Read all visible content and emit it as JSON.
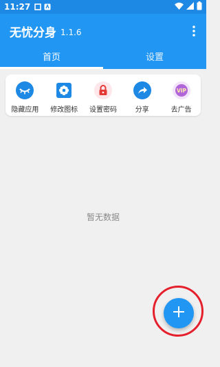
{
  "status_bar": {
    "time": "11:27",
    "notification_icons": [
      "square-icon",
      "app-icon"
    ],
    "right_icons": [
      "wifi-icon",
      "signal-icon",
      "battery-icon"
    ]
  },
  "app_bar": {
    "title": "无忧分身",
    "version": "1.1.6",
    "menu_icon": "more-vert-icon"
  },
  "tabs": [
    {
      "label": "首页",
      "active": true
    },
    {
      "label": "设置",
      "active": false
    }
  ],
  "quick_actions": [
    {
      "label": "隐藏应用",
      "icon": "closed-eye-icon",
      "color": "#1e88e5"
    },
    {
      "label": "修改图标",
      "icon": "flower-icon",
      "color": "#1e88e5"
    },
    {
      "label": "设置密码",
      "icon": "lock-icon",
      "color": "#e53935"
    },
    {
      "label": "分享",
      "icon": "share-arrow-icon",
      "color": "#1e88e5"
    },
    {
      "label": "去广告",
      "icon": "vip-icon",
      "color": "#b066d8"
    }
  ],
  "empty_state": {
    "text": "暂无数据"
  },
  "fab": {
    "icon": "plus-icon",
    "color": "#2196f3",
    "highlight_color": "#e51f2b"
  },
  "colors": {
    "primary": "#2196f3",
    "status_bar": "#1e88e5",
    "background": "#f0f0f0"
  }
}
